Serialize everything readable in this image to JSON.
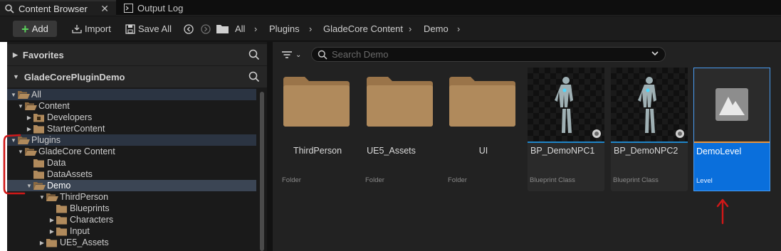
{
  "tabs": [
    {
      "label": "Content Browser",
      "close": "✕"
    },
    {
      "label": "Output Log"
    }
  ],
  "toolbar": {
    "add_label": "Add",
    "import_label": "Import",
    "save_all_label": "Save All",
    "breadcrumbs": [
      "All",
      "Plugins",
      "GladeCore Content",
      "Demo"
    ]
  },
  "sources": {
    "favorites_label": "Favorites",
    "project_label": "GladeCorePluginDemo",
    "tree": [
      {
        "label": "All"
      },
      {
        "label": "Content"
      },
      {
        "label": "Developers"
      },
      {
        "label": "StarterContent"
      },
      {
        "label": "Plugins"
      },
      {
        "label": "GladeCore Content"
      },
      {
        "label": "Data"
      },
      {
        "label": "DataAssets"
      },
      {
        "label": "Demo"
      },
      {
        "label": "ThirdPerson"
      },
      {
        "label": "Blueprints"
      },
      {
        "label": "Characters"
      },
      {
        "label": "Input"
      },
      {
        "label": "UE5_Assets"
      }
    ]
  },
  "search": {
    "placeholder": "Search Demo"
  },
  "assets": [
    {
      "name": "ThirdPerson",
      "type": "Folder"
    },
    {
      "name": "UE5_Assets",
      "type": "Folder"
    },
    {
      "name": "UI",
      "type": "Folder"
    },
    {
      "name": "BP_DemoNPC1",
      "type": "Blueprint Class"
    },
    {
      "name": "BP_DemoNPC2",
      "type": "Blueprint Class"
    },
    {
      "name": "DemoLevel",
      "type": "Level"
    }
  ],
  "colors": {
    "folder": "#b08a5c",
    "selection": "#0a6fdc",
    "blueprint_bar": "#1f86c9",
    "level_bar": "#e8933a",
    "annotation": "#d01818"
  }
}
